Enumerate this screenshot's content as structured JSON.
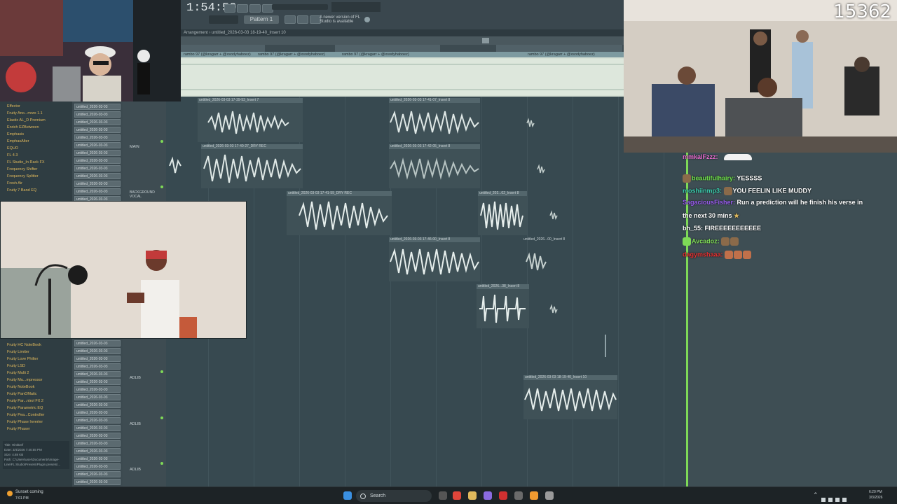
{
  "stream": {
    "viewer_count": "15362"
  },
  "daw": {
    "clock": "1:54:50",
    "pattern_label": "Pattern 1",
    "update_notice": "A newer version of FL Studio is available",
    "arrangement_title": "Arrangement › untitled_2026-03-03 18-19-40_Insert 10",
    "top_track_labels": [
      "rambo 97 (@kragarr + @xsodyhaboez)",
      "rambo 97 (@kragarr + @xsodyhaboez)",
      "rambo 97 (@kragarr + @xsodyhaboez)",
      "rambo 97 (@kragarr + @xsodyhaboez)"
    ],
    "browser_items_top": [
      "Effector",
      "Fruity Ano...mrzo 1.1",
      "Elastic AL_D Premium",
      "Enrich EZBetween",
      "Emphasis",
      "EmphasAlter",
      "EQUO",
      "FL 4.3",
      "FL Studio_In Rack FX",
      "Frequency Shifter",
      "Frequency Splitter",
      "Fresh Air",
      "Fruity 7 Band EQ"
    ],
    "browser_items_bottom": [
      "Fruity HC NoteBook",
      "Fruity Limiter",
      "Fruity Love Philter",
      "Fruity LSD",
      "Fruity Multi 2",
      "Fruity Mu...mpressor",
      "Fruity NoteBook",
      "Fruity PanOMatic",
      "Fruity Par...ntrol FX 2",
      "Fruity Parametric EQ",
      "Fruity Pea...Controller",
      "Fruity Phase Inverter",
      "Fruity Phaser"
    ],
    "mixer_slots_top": [
      "untitled_2026-03-03",
      "untitled_2026-03-03",
      "untitled_2026-03-03",
      "untitled_2026-03-03",
      "untitled_2026-03-03",
      "untitled_2026-03-03",
      "untitled_2026-03-03",
      "untitled_2026-03-03",
      "untitled_2026-03-03",
      "untitled_2026-03-03",
      "untitled_2026-03-03",
      "untitled_2026-03-03",
      "untitled_2026-03-03"
    ],
    "mixer_slots_bottom": [
      "untitled_2026-03-03",
      "untitled_2026-03-03",
      "untitled_2026-03-03",
      "untitled_2026-03-03",
      "untitled_2026-03-03",
      "untitled_2026-03-03",
      "untitled_2026-03-03",
      "untitled_2026-03-03",
      "untitled_2026-03-03",
      "untitled_2026-03-03",
      "untitled_2026-03-03",
      "untitled_2026-03-03",
      "untitled_2026-03-03",
      "untitled_2026-03-03",
      "untitled_2026-03-03",
      "untitled_2026-03-03",
      "untitled_2026-03-03",
      "untitled_2026-03-03",
      "untitled_2026-03-03"
    ],
    "track_labels": [
      "MAIN",
      "BACKGROUND VOCAL",
      "ADLIB",
      "ADLIB",
      "ADLIB"
    ],
    "clips": [
      {
        "title": "untitled_2026-03-03 17-39-53_Insert 7"
      },
      {
        "title": "untitled_2026-03-03 17-41-07_Insert 8"
      },
      {
        "title": "untitled_2026-03-03 17-40-27_DRY REC"
      },
      {
        "title": "untitled_2026-03-03 17-42-05_Insert 8"
      },
      {
        "title": "untitled_2026-03-03 17-41-59_DRY REC"
      },
      {
        "title": "untitled_202...02_Insert 8"
      },
      {
        "title": "untitled_2026-03-03 17-46-00_Insert 8"
      },
      {
        "title": "untitled_2026...00_Insert 8"
      },
      {
        "title": "untitled_2026-03-03 18-19-40_Insert 10"
      }
    ],
    "info_panel_lines": [
      "Title: Hint/Def",
      "Date: 3/4/2026 7:40:55 PM",
      "Size: 4.88 KB",
      "Path: C:\\Users\\user\\Documents\\Image-Line\\FL Studio\\Presets\\Plugin presets\\..."
    ]
  },
  "chat": {
    "messages": [
      {
        "user": "mmkalFzzz:",
        "user_color": "#e86cd0",
        "text": ""
      },
      {
        "user": "beautifulhairy:",
        "user_color": "#6fe04a",
        "text": "YESSSS"
      },
      {
        "user": "moshiinmp3:",
        "user_color": "#3bd0b0",
        "text": "YOU FEELIN LIKE MUDDY"
      },
      {
        "user": "SagaciousFisher:",
        "user_color": "#9a5cf0",
        "text": "Run a prediction will he finish his verse in"
      },
      {
        "user": "",
        "user_color": "#ffffff",
        "text": "the next 30 mins"
      },
      {
        "user": "bh_55:",
        "user_color": "#ffffff",
        "text": "FIREEEEEEEEEEE"
      },
      {
        "user": "Avcadoz:",
        "user_color": "#7ed957",
        "text": ""
      },
      {
        "user": "dagymshaaa:",
        "user_color": "#e83030",
        "text": ""
      }
    ]
  },
  "taskbar": {
    "notification": "Sunset coming",
    "notification_time": "7:01 PM",
    "search_placeholder": "Search",
    "clock_time": "6:20 PM",
    "clock_date": "3/3/2026"
  },
  "colors": {
    "playhead": "#7ed957",
    "waveform": "#dfe8e6",
    "browser_text": "#e0b95c",
    "clip_bg": "#3f5157"
  }
}
